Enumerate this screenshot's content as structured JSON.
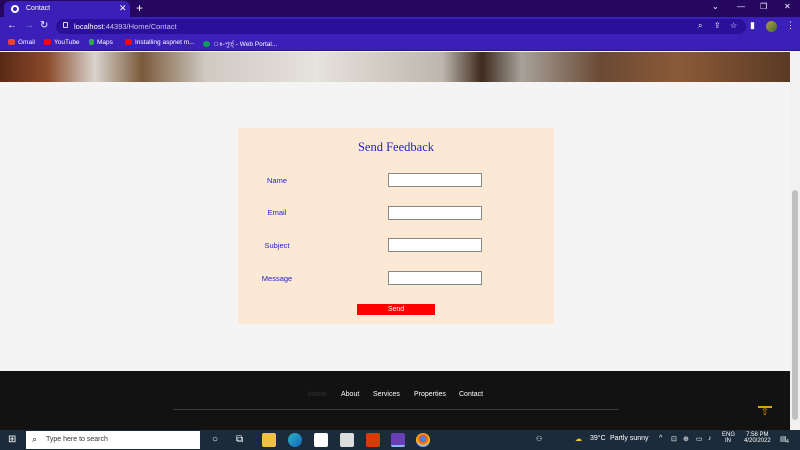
{
  "browser": {
    "tab_title": "Contact",
    "tab_close": "✕",
    "new_tab": "+",
    "url_host": "localhost",
    "url_path": ":44393/Home/Contact",
    "window_controls": [
      "⌄",
      "—",
      "❐",
      "✕"
    ],
    "bookmarks": [
      {
        "label": "Gmail",
        "color": "#ea4335"
      },
      {
        "label": "YouTube",
        "color": "#ff0000"
      },
      {
        "label": "Maps",
        "color": "#34a853"
      },
      {
        "label": "Installing aspnet m...",
        "color": "#ff0000"
      },
      {
        "label": "ঃ-পুর্ত্ - Web Portal...",
        "color": "#0f9d58"
      }
    ]
  },
  "form": {
    "title": "Send Feedback",
    "fields": [
      {
        "label": "Name",
        "value": ""
      },
      {
        "label": "Email",
        "value": ""
      },
      {
        "label": "Subject",
        "value": ""
      },
      {
        "label": "Message",
        "value": ""
      }
    ],
    "send_label": "Send",
    "colors": {
      "card": "#fbe9d6",
      "label": "#2222cc",
      "button": "#ff0000"
    }
  },
  "footer": {
    "nav": [
      "Home",
      "About",
      "Services",
      "Properties",
      "Contact"
    ],
    "to_top_icon": "arrow-up-icon"
  },
  "taskbar": {
    "search_placeholder": "Type here to search",
    "weather_temp": "39°C",
    "weather_desc": "Partly sunny",
    "lang_line1": "ENG",
    "lang_line2": "IN",
    "time": "7:58 PM",
    "date": "4/20/2022",
    "notifications": "4"
  }
}
